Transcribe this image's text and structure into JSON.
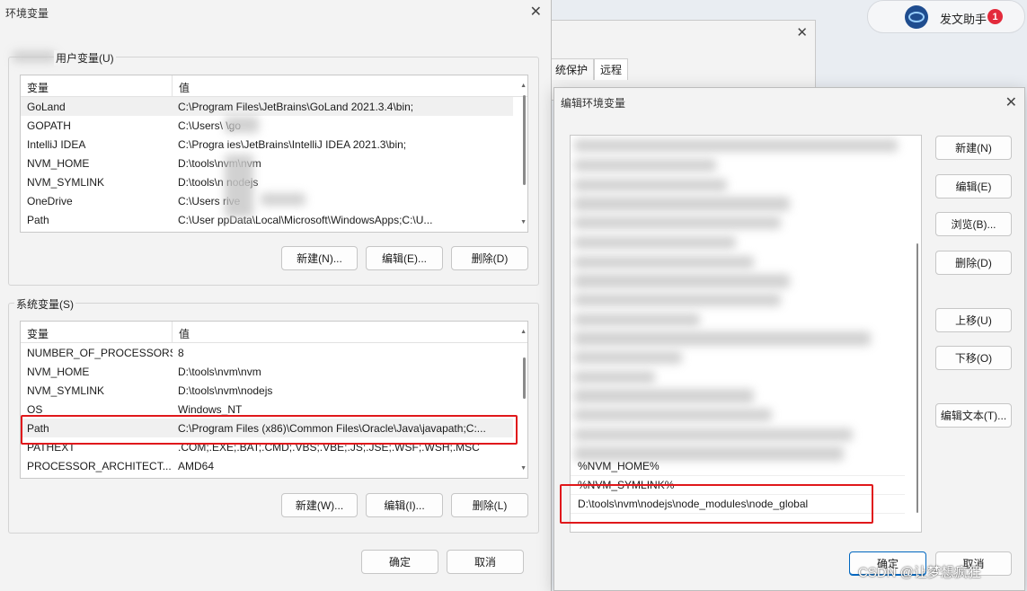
{
  "main_dialog": {
    "title": "环境变量",
    "user_group_label": "用户变量(U)",
    "system_group_label": "系统变量(S)",
    "columns": {
      "variable": "变量",
      "value": "值"
    },
    "user_vars": [
      {
        "name": "GoLand",
        "value": "C:\\Program Files\\JetBrains\\GoLand 2021.3.4\\bin;"
      },
      {
        "name": "GOPATH",
        "value": "C:\\Users\\      \\go"
      },
      {
        "name": "IntelliJ IDEA",
        "value": "C:\\Progra       ies\\JetBrains\\IntelliJ IDEA 2021.3\\bin;"
      },
      {
        "name": "NVM_HOME",
        "value": "D:\\tools\\nvm\\nvm"
      },
      {
        "name": "NVM_SYMLINK",
        "value": "D:\\tools\\n    nodejs"
      },
      {
        "name": "OneDrive",
        "value": "C:\\Users              rive"
      },
      {
        "name": "Path",
        "value": "C:\\User                ppData\\Local\\Microsoft\\WindowsApps;C:\\U..."
      }
    ],
    "user_buttons": {
      "new": "新建(N)...",
      "edit": "编辑(E)...",
      "delete": "删除(D)"
    },
    "system_vars": [
      {
        "name": "NUMBER_OF_PROCESSORS",
        "value": "8"
      },
      {
        "name": "NVM_HOME",
        "value": "D:\\tools\\nvm\\nvm"
      },
      {
        "name": "NVM_SYMLINK",
        "value": "D:\\tools\\nvm\\nodejs"
      },
      {
        "name": "OS",
        "value": "Windows_NT"
      },
      {
        "name": "Path",
        "value": "C:\\Program Files (x86)\\Common Files\\Oracle\\Java\\javapath;C:..."
      },
      {
        "name": "PATHEXT",
        "value": ".COM;.EXE;.BAT;.CMD;.VBS;.VBE;.JS;.JSE;.WSF;.WSH;.MSC"
      },
      {
        "name": "PROCESSOR_ARCHITECT...",
        "value": "AMD64"
      }
    ],
    "system_buttons": {
      "new": "新建(W)...",
      "edit": "编辑(I)...",
      "delete": "删除(L)"
    },
    "ok": "确定",
    "cancel": "取消"
  },
  "bg_window": {
    "tabs": [
      "统保护",
      "远程"
    ]
  },
  "assistant": {
    "label": "发文助手",
    "badge": "1"
  },
  "edit_dialog": {
    "title": "编辑环境变量",
    "entries_visible": [
      "%NVM_HOME%",
      "%NVM_SYMLINK%",
      "D:\\tools\\nvm\\nodejs\\node_modules\\node_global"
    ],
    "buttons": {
      "new": "新建(N)",
      "edit": "编辑(E)",
      "browse": "浏览(B)...",
      "delete": "删除(D)",
      "up": "上移(U)",
      "down": "下移(O)",
      "edit_text": "编辑文本(T)..."
    },
    "ok": "确定",
    "cancel": "取消"
  },
  "watermark": "CSDN @让梦想疯狂",
  "colors": {
    "highlight_box": "#e0181b",
    "accent": "#0067c0",
    "badge": "#e32b3c"
  }
}
